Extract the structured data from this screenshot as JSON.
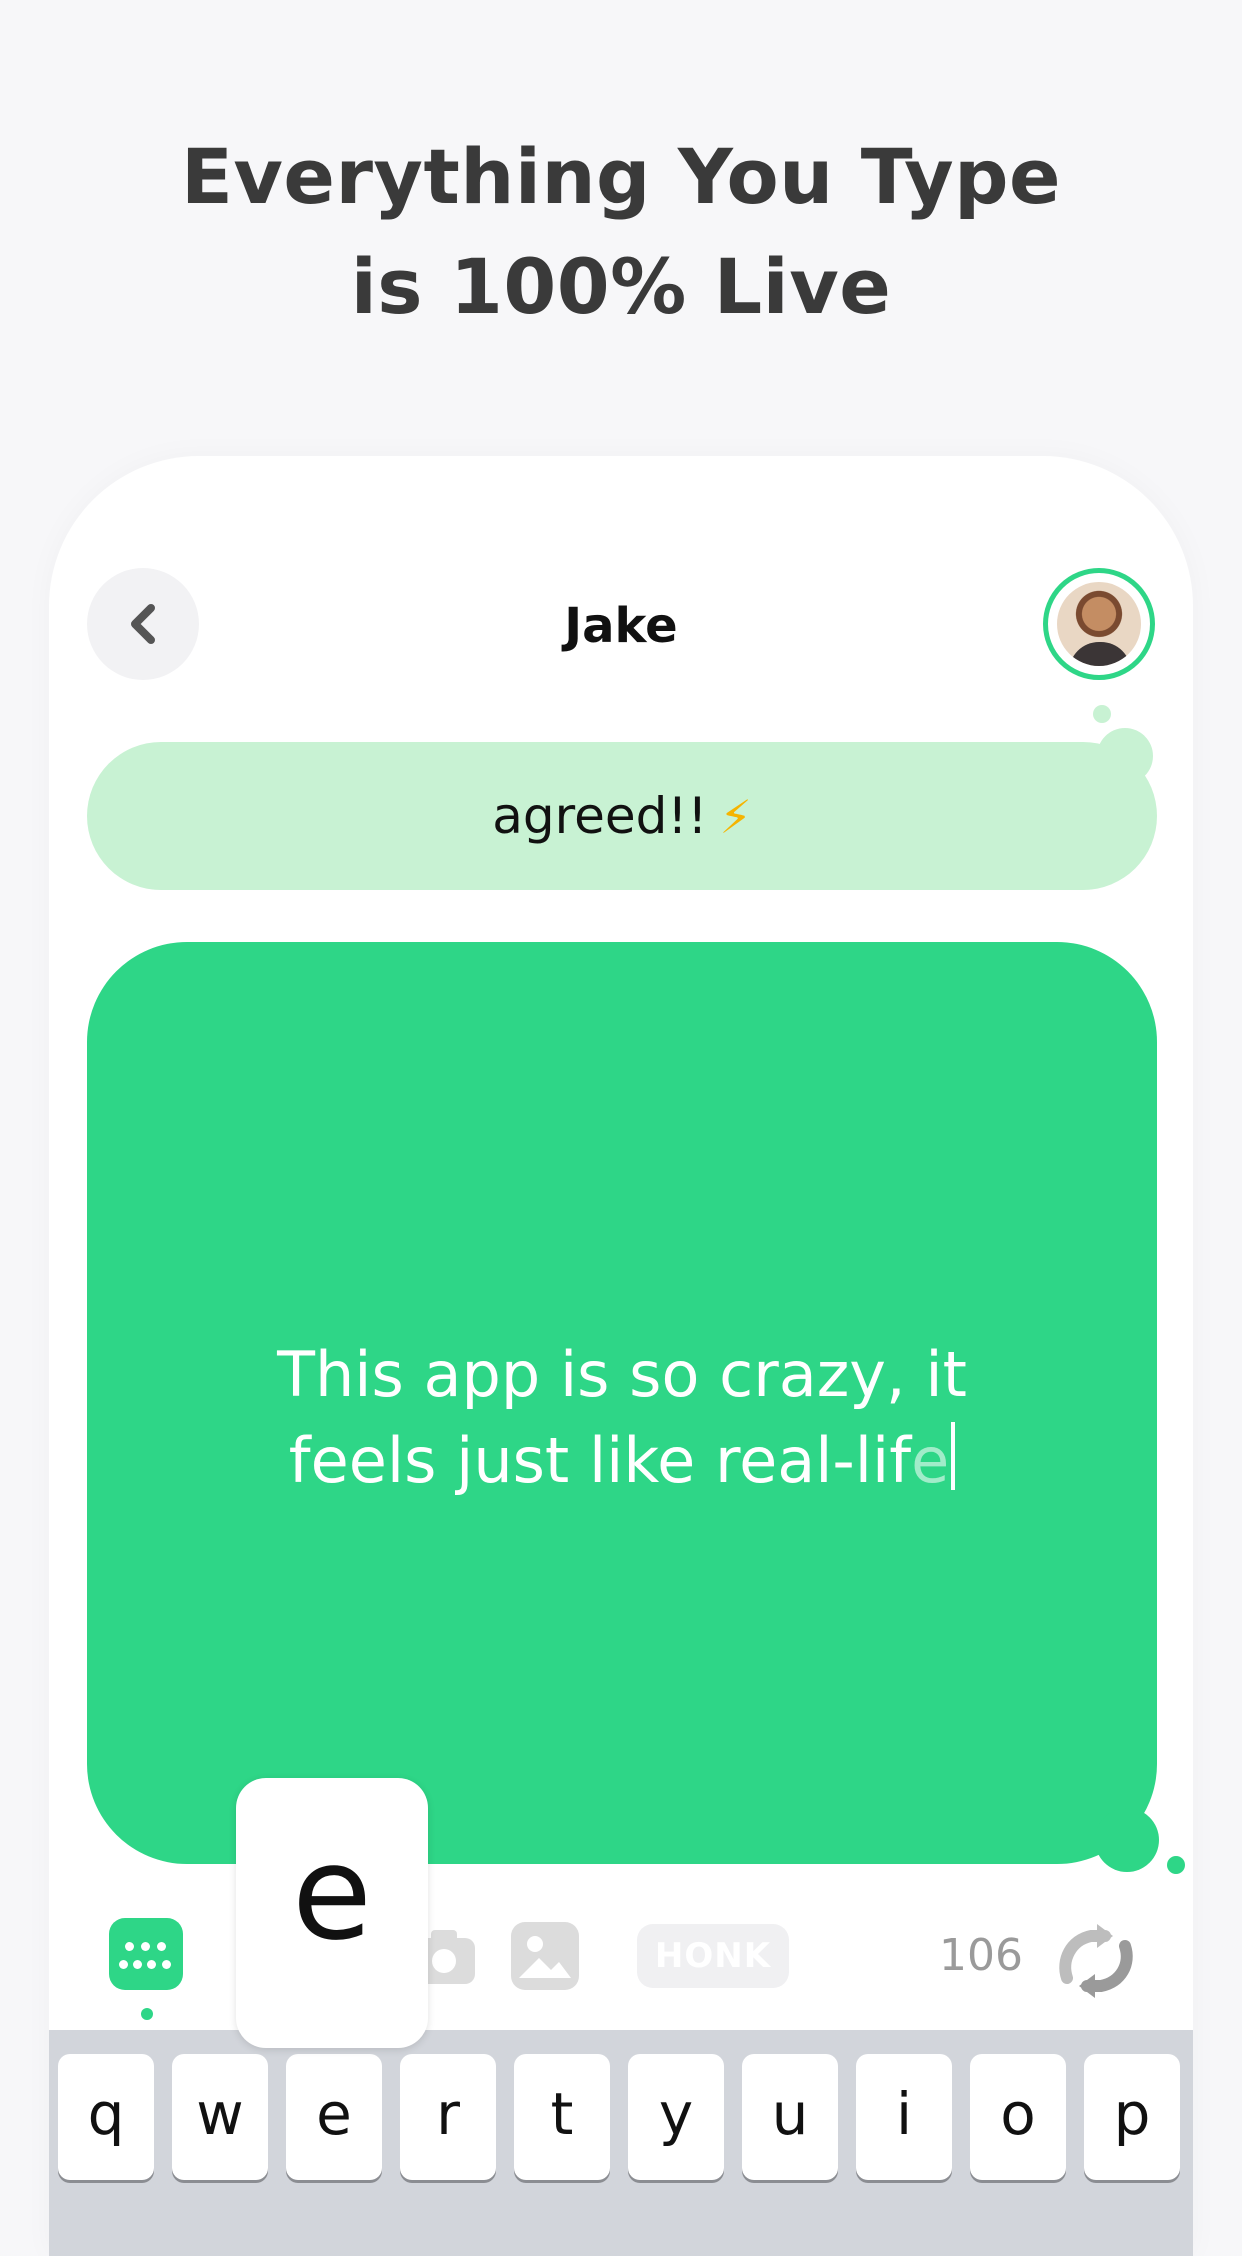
{
  "headline": {
    "line1": "Everything You Type",
    "line2": "is 100% Live"
  },
  "chat": {
    "contact_name": "Jake",
    "incoming_message": "agreed!!",
    "incoming_emoji": "⚡",
    "outgoing_message_line1": "This app is so crazy, it",
    "outgoing_message_line2_main": "feels just like real-lif",
    "outgoing_message_line2_ghost": "e"
  },
  "toolbar": {
    "honk_label": "HONK",
    "char_count": "106",
    "icons": [
      "keyboard-icon",
      "camera-icon",
      "photo-icon",
      "refresh-icon"
    ]
  },
  "keyboard": {
    "row1": [
      "q",
      "w",
      "e",
      "r",
      "t",
      "y",
      "u",
      "i",
      "o",
      "p"
    ],
    "pressed_key": "e"
  },
  "colors": {
    "accent_green": "#2ed687",
    "light_green": "#c8f2d3",
    "background": "#f7f7f9",
    "bolt": "#f5b400"
  }
}
